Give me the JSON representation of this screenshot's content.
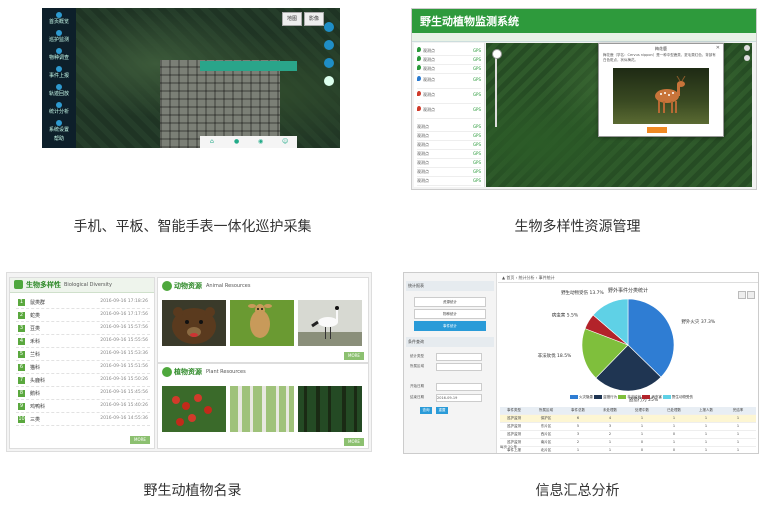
{
  "captions": {
    "patrol": "手机、平板、智能手表一体化巡护采集",
    "biodiversity": "生物多样性资源管理",
    "catalog": "野生动植物名录",
    "analysis": "信息汇总分析"
  },
  "patrol_app": {
    "sidebar": [
      "首页概览",
      "巡护监测",
      "物种调查",
      "事件上报",
      "轨迹回放",
      "统计分析",
      "系统设置",
      "帮助"
    ],
    "top_buttons": [
      "地图",
      "影像"
    ],
    "phone_bottom_icons": [
      "home-icon",
      "location-icon",
      "camera-icon",
      "user-icon"
    ]
  },
  "monitor_system": {
    "title": "野生动植物监测系统",
    "list_rows": [
      {
        "text": "观测点",
        "tag": "GPS"
      },
      {
        "text": "观测点",
        "tag": "GPS"
      },
      {
        "text": "观测点",
        "tag": "GPS"
      },
      {
        "text": "观测点",
        "tag": "GPS"
      },
      {
        "text": "观测点",
        "tag": "GPS"
      },
      {
        "text": "观测点",
        "tag": "GPS"
      },
      {
        "text": "观测点",
        "tag": "GPS"
      },
      {
        "text": "观测点",
        "tag": "GPS"
      },
      {
        "text": "观测点",
        "tag": "GPS"
      },
      {
        "text": "观测点",
        "tag": "GPS"
      },
      {
        "text": "观测点",
        "tag": "GPS"
      },
      {
        "text": "观测点",
        "tag": "GPS"
      },
      {
        "text": "观测点",
        "tag": "GPS"
      },
      {
        "text": "观测点",
        "tag": "GPS"
      }
    ],
    "popup_title": "梅花鹿",
    "popup_text": "梅花鹿（学名：Cervus nippon）是一种中型鹿类，夏毛栗红色，背部有白色斑点，状似梅花。"
  },
  "catalog": {
    "biodiversity_cn": "生物多样性",
    "biodiversity_en": "Biological Diversity",
    "items": [
      {
        "num": "1",
        "name": "鼠类群",
        "date": "2016-09-16 17:18:26"
      },
      {
        "num": "2",
        "name": "蛇类",
        "date": "2016-09-16 17:17:56"
      },
      {
        "num": "3",
        "name": "豆类",
        "date": "2016-09-16 15:57:56"
      },
      {
        "num": "4",
        "name": "禾科",
        "date": "2016-09-16 15:55:56"
      },
      {
        "num": "5",
        "name": "兰科",
        "date": "2016-09-16 15:53:36"
      },
      {
        "num": "6",
        "name": "猫科",
        "date": "2016-09-16 15:51:56"
      },
      {
        "num": "7",
        "name": "头鹿科",
        "date": "2016-09-16 15:50:26"
      },
      {
        "num": "8",
        "name": "鹅科",
        "date": "2016-09-16 15:45:56"
      },
      {
        "num": "9",
        "name": "鸡鸭科",
        "date": "2016-09-16 15:40:26"
      },
      {
        "num": "10",
        "name": "三类",
        "date": "2016-09-16 14:55:36"
      }
    ],
    "animal_cn": "动物资源",
    "animal_en": "Animal Resources",
    "plant_cn": "植物资源",
    "plant_en": "Plant Resources",
    "more_label": "MORE"
  },
  "analysis": {
    "left_sections": [
      "统计报表",
      "条件查询"
    ],
    "left_buttons": [
      "资源统计",
      "物种统计",
      "事件统计"
    ],
    "form_labels": [
      "统计类型",
      "所属区域",
      "开始日期",
      "结束日期"
    ],
    "end_date": "2016-09-19",
    "query_labels": [
      "查询",
      "重置"
    ],
    "breadcrumb": "▲ 首页 › 统计分析 › 事件统计",
    "chart_title": "野外事件分类统计",
    "legend": [
      "火灾隐患",
      "盗猎行为",
      "非法砍伐",
      "病虫害",
      "野生动物受伤"
    ],
    "table_headers": [
      "事件类型",
      "所属区域",
      "事件总数",
      "未处理数",
      "处理中数",
      "已处理数",
      "上报人数",
      "完结率"
    ],
    "table_rows": [
      [
        "巡护监测",
        "保护区",
        "6",
        "4",
        "1",
        "1",
        "1",
        "1"
      ],
      [
        "巡护监测",
        "东片区",
        "5",
        "3",
        "1",
        "1",
        "1",
        "1"
      ],
      [
        "巡护监测",
        "西片区",
        "3",
        "2",
        "1",
        "0",
        "1",
        "1"
      ],
      [
        "巡护监测",
        "南片区",
        "2",
        "1",
        "0",
        "1",
        "1",
        "1"
      ],
      [
        "事件上报",
        "北片区",
        "1",
        "1",
        "0",
        "0",
        "1",
        "1"
      ]
    ],
    "pager_text": "每页 20 条"
  },
  "chart_data": {
    "type": "pie",
    "title": "野外事件分类统计",
    "labels": [
      "野外火灾",
      "盗猎行为",
      "非法砍伐",
      "病虫害",
      "野生动物受伤"
    ],
    "values": [
      37.3,
      25.0,
      18.5,
      5.5,
      13.7
    ],
    "colors": [
      "#2f7dd3",
      "#1f3552",
      "#7fbf3c",
      "#b3232a",
      "#5fd1e6"
    ]
  },
  "colors": {
    "brand_green": "#2e9a3c",
    "accent_blue": "#2a9bd8"
  }
}
